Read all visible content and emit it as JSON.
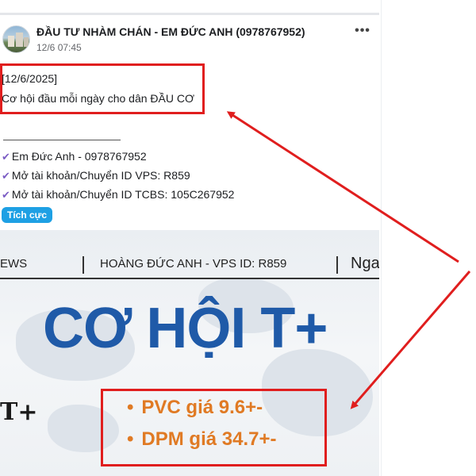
{
  "post": {
    "author": "ĐẦU TƯ NHÀM CHÁN - EM ĐỨC ANH (0978767952)",
    "timestamp": "12/6 07:45",
    "more_icon": "more-dots-icon",
    "date_line": "[12/6/2025]",
    "headline": "Cơ hội đầu mỗi ngày cho dân ĐẦU CƠ",
    "separator": "____________________",
    "contacts": [
      "Em Đức Anh - 0978767952",
      "Mở tài khoản/Chuyển ID VPS: R859",
      "Mở tài khoản/Chuyển ID TCBS: 105C267952"
    ],
    "check_icon": "checkmark-icon",
    "tag": "Tích cực"
  },
  "banner": {
    "news_left": "EWS",
    "news_mid": "HOÀNG ĐỨC ANH - VPS ID: R859",
    "news_right": "Nga",
    "title": "CƠ HỘI T+",
    "side_text": "T+",
    "stocks": [
      "PVC giá 9.6+-",
      "DPM giá 34.7+-"
    ]
  },
  "colors": {
    "highlight": "#e01e1e",
    "title_blue": "#1f5aa8",
    "stock_orange": "#e07a24",
    "tag_blue": "#1ea0e4",
    "check_purple": "#7b5cc4"
  }
}
